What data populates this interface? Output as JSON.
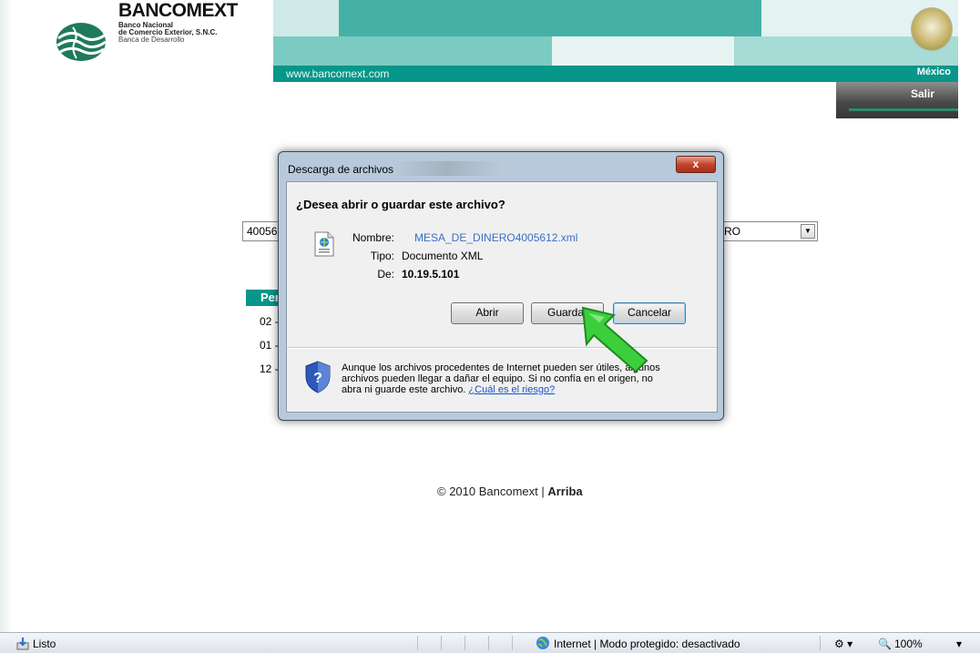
{
  "header": {
    "brand_name": "BANCOMEXT",
    "brand_sub1": "Banco Nacional",
    "brand_sub2": "de Comercio Exterior, S.N.C.",
    "brand_sub3": "Banca de Desarrollo",
    "url": "www.bancomext.com",
    "country": "México",
    "logout_label": "Salir"
  },
  "page": {
    "select_left_text": "40056",
    "select_right_text": "RO",
    "period_header": "Per",
    "period_rows": [
      "02 -",
      "01 -",
      "12 -"
    ],
    "footer_text": "© 2010 Bancomext | ",
    "footer_link": "Arriba"
  },
  "dialog": {
    "title": "Descarga de archivos",
    "close_label": "x",
    "question": "¿Desea abrir o guardar este archivo?",
    "name_label": "Nombre:",
    "name_value": "MESA_DE_DINERO4005612.xml",
    "type_label": "Tipo:",
    "type_value": "Documento XML",
    "from_label": "De:",
    "from_value": "10.19.5.101",
    "btn_open": "Abrir",
    "btn_save": "Guardar",
    "btn_cancel": "Cancelar",
    "warning_text": "Aunque los archivos procedentes de Internet pueden ser útiles, algunos archivos pueden llegar a dañar el equipo. Si no confía en el origen, no abra ni guarde este archivo. ",
    "warning_link": "¿Cuál es el riesgo?"
  },
  "statusbar": {
    "status": "Listo",
    "zone": "Internet | Modo protegido: desactivado",
    "zoom": "100%"
  },
  "colors": {
    "teal": "#07968a",
    "dialog_frame": "#b7c9da",
    "cursor_green": "#3ccf3c"
  },
  "icons": {
    "logo": "globe-logo-icon",
    "seal": "mexico-seal-icon",
    "file": "xml-file-icon",
    "shield": "security-shield-icon",
    "cursor": "green-arrow-cursor-icon",
    "status": "page-done-icon",
    "globe": "internet-globe-icon",
    "zoom": "zoom-magnifier-icon"
  }
}
